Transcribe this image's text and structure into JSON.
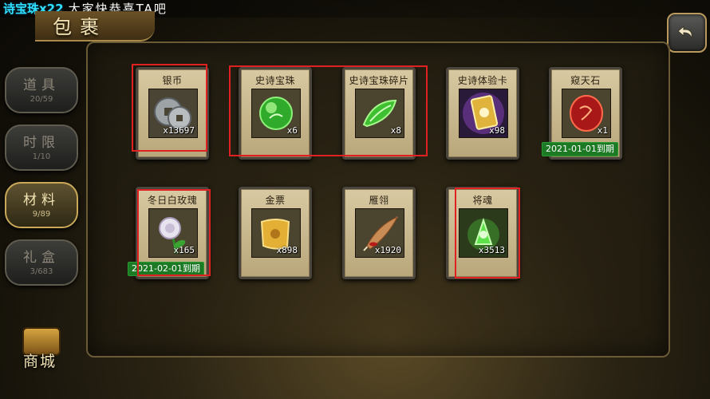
{
  "ticker": {
    "highlight": "诗宝珠x22",
    "message": "大家快恭喜TA吧"
  },
  "title": "包裹",
  "tabs": [
    {
      "label": "道具",
      "count": "20/59",
      "active": false
    },
    {
      "label": "时限",
      "count": "1/10",
      "active": false
    },
    {
      "label": "材料",
      "count": "9/89",
      "active": true
    },
    {
      "label": "礼盒",
      "count": "3/683",
      "active": false
    }
  ],
  "shop": {
    "label": "商城"
  },
  "items": [
    {
      "name": "银币",
      "count": "x13697",
      "icon": "silver-coin-icon",
      "expiry": ""
    },
    {
      "name": "史诗宝珠",
      "count": "x6",
      "icon": "green-orb-icon",
      "expiry": ""
    },
    {
      "name": "史诗宝珠碎片",
      "count": "x8",
      "icon": "green-shard-icon",
      "expiry": ""
    },
    {
      "name": "史诗体验卡",
      "count": "x98",
      "icon": "golden-card-icon",
      "expiry": ""
    },
    {
      "name": "窥天石",
      "count": "x1",
      "icon": "red-stone-icon",
      "expiry": "2021-01-01到期"
    },
    {
      "name": "冬日白玫瑰",
      "count": "x165",
      "icon": "white-rose-icon",
      "expiry": "2021-02-01到期"
    },
    {
      "name": "金票",
      "count": "x898",
      "icon": "gold-scroll-icon",
      "expiry": ""
    },
    {
      "name": "雁翎",
      "count": "x1920",
      "icon": "feather-icon",
      "expiry": ""
    },
    {
      "name": "将魂",
      "count": "x3513",
      "icon": "green-soul-icon",
      "expiry": ""
    }
  ],
  "colors": {
    "highlight_box": "#e02121",
    "expiry_badge": "#1d7a24",
    "ticker_highlight": "#2fe0ff"
  }
}
